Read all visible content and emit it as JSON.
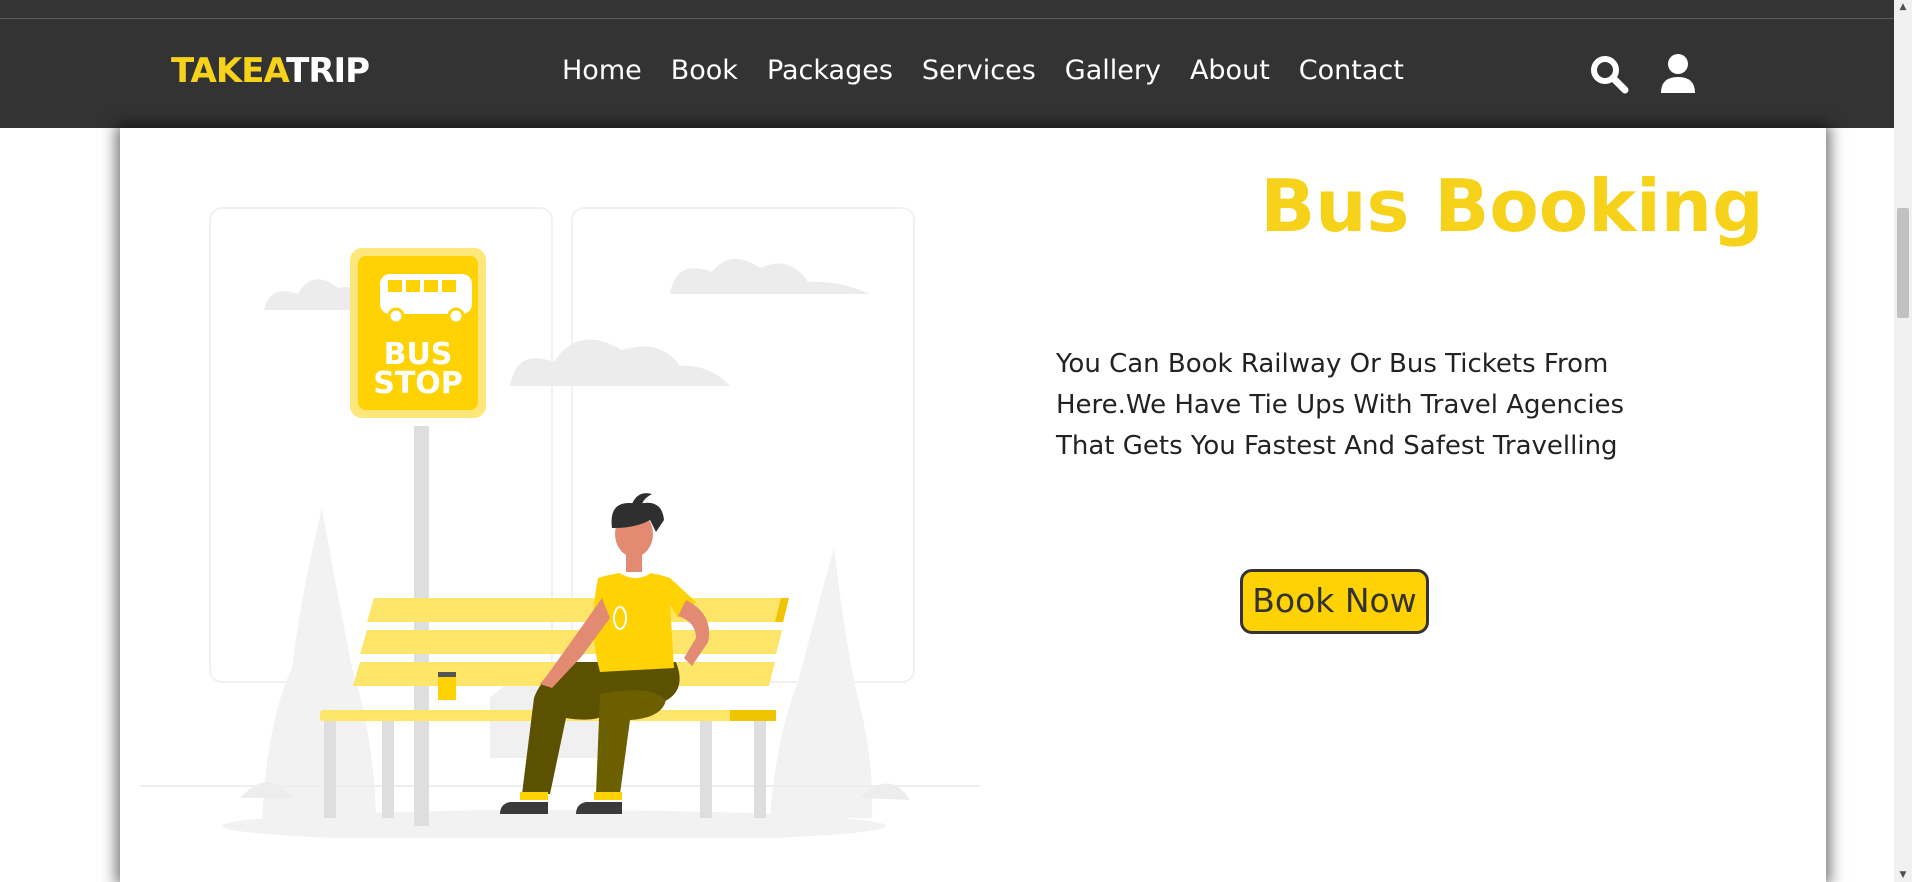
{
  "brand": {
    "logo_part1": "TAKEA",
    "logo_part2": "TRIP"
  },
  "nav": {
    "items": [
      "Home",
      "Book",
      "Packages",
      "Services",
      "Gallery",
      "About",
      "Contact"
    ]
  },
  "header_icons": [
    "search-icon",
    "user-icon"
  ],
  "illustration": {
    "sign_line1": "BUS",
    "sign_line2": "STOP"
  },
  "hero": {
    "title": "Bus Booking",
    "description": "You Can Book Railway Or Bus Tickets From Here.We Have Tie Ups With Travel Agencies That Gets You Fastest And Safest Travelling",
    "button_label": "Book Now"
  },
  "colors": {
    "accent": "#f7d21a",
    "navbar": "#333333",
    "button": "#fed203",
    "text": "#222222"
  }
}
